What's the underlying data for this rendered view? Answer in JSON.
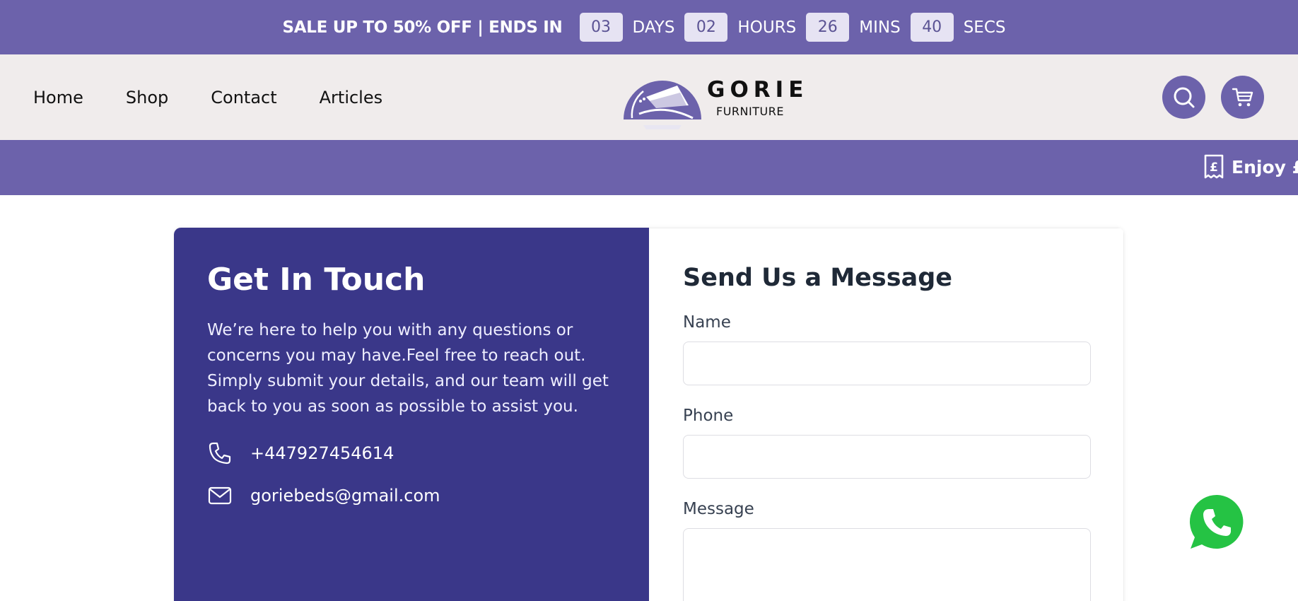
{
  "sale_bar": {
    "text": "SALE UP TO 50% OFF | ENDS IN",
    "days_value": "03",
    "days_label": "DAYS",
    "hours_value": "02",
    "hours_label": "HOURS",
    "mins_value": "26",
    "mins_label": "MINS",
    "secs_value": "40",
    "secs_label": "SECS"
  },
  "nav": {
    "items": [
      {
        "label": "Home"
      },
      {
        "label": "Shop"
      },
      {
        "label": "Contact"
      },
      {
        "label": "Articles"
      }
    ]
  },
  "logo": {
    "word": "GORIE",
    "sub": "FURNITURE"
  },
  "header_icons": {
    "search": "search-icon",
    "cart": "cart-icon"
  },
  "promo": {
    "text": "Enjoy £",
    "icon": "receipt-pound-icon"
  },
  "contact_info": {
    "title": "Get In Touch",
    "description": "We’re here to help you with any questions or concerns you may have.Feel free to reach out. Simply submit your details, and our team will get back to you as soon as possible to assist you.",
    "phone": "+447927454614",
    "email": "goriebeds@gmail.com"
  },
  "form": {
    "title": "Send Us a Message",
    "name_label": "Name",
    "phone_label": "Phone",
    "message_label": "Message"
  },
  "colors": {
    "brand_purple": "#6c62ab",
    "card_navy": "#3a3789",
    "header_bg": "#f0ecec",
    "whatsapp_green": "#25c344"
  }
}
